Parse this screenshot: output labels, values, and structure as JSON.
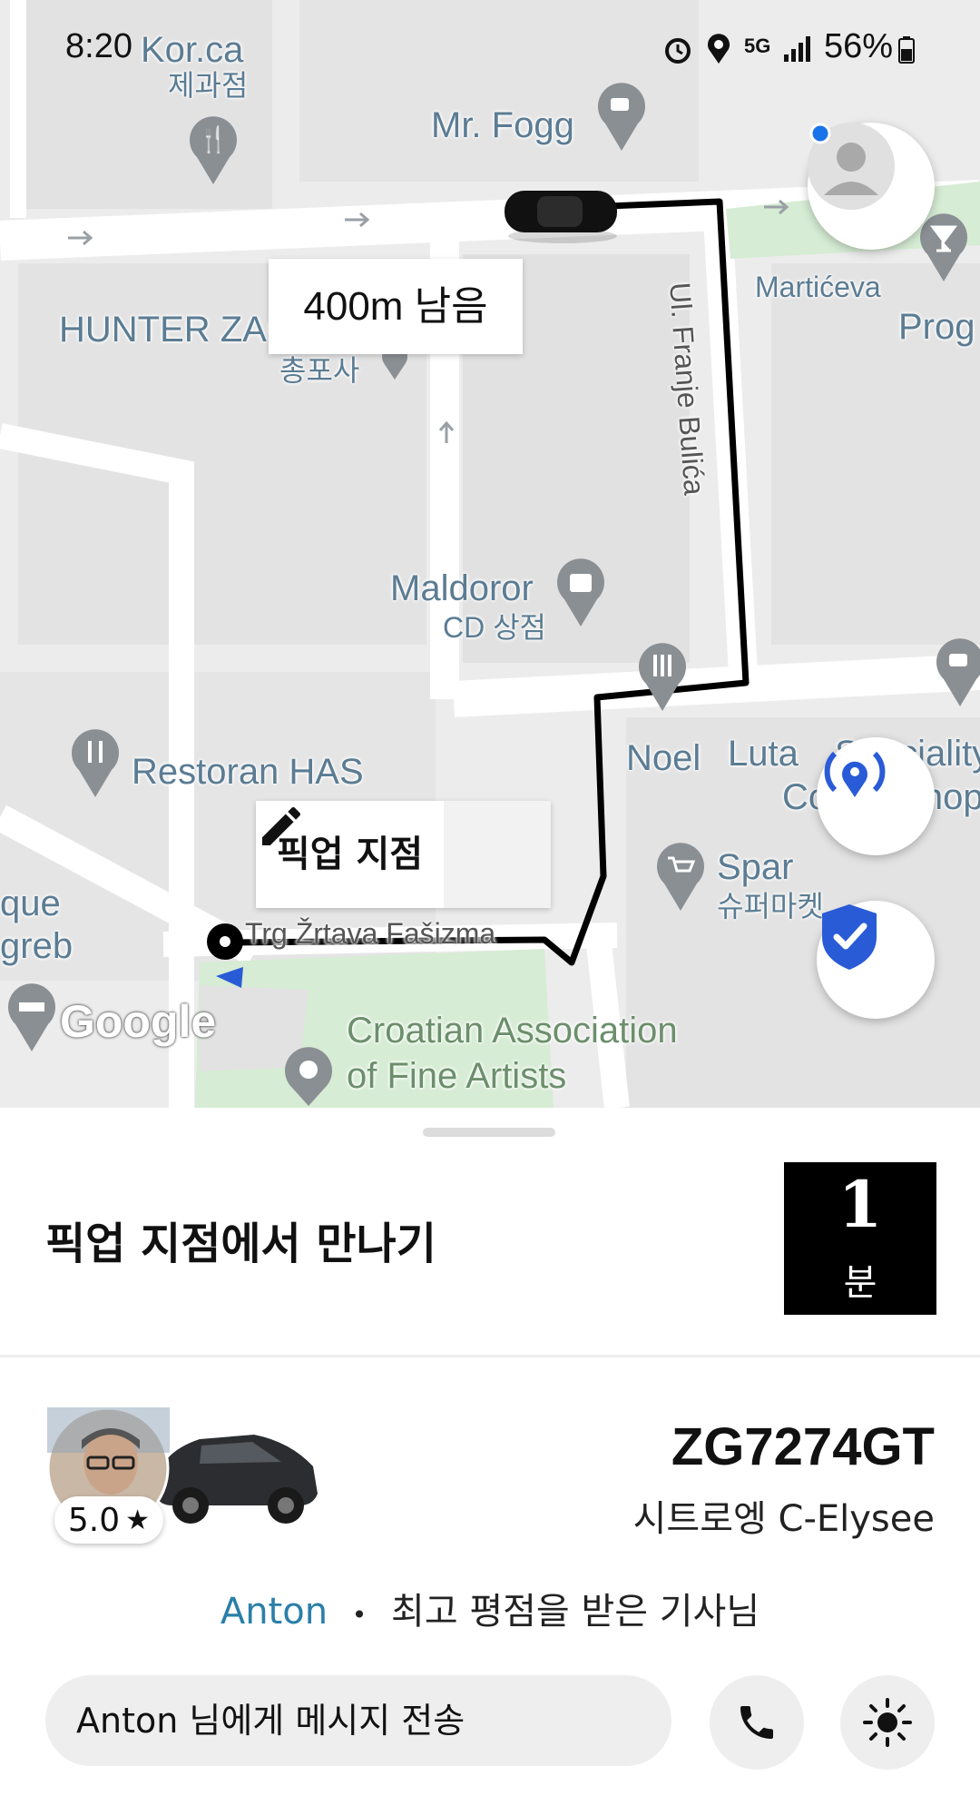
{
  "status_bar": {
    "time": "8:20",
    "battery": "56%",
    "network": "5G"
  },
  "map": {
    "distance_label": "400m 남음",
    "pickup_label": "픽업 지점",
    "google_logo": "Google",
    "pois": {
      "top_left_store_partial": "Kor.ca",
      "top_left_store_sub": "제과점",
      "mr_fogg": "Mr. Fogg",
      "marticeva": "Martićeva",
      "prog_partial": "Prog",
      "hunter": "HUNTER ZAG",
      "hunter_sub": "총포사",
      "street_franc": "Ul. Franje Bulića",
      "maldoror": "Maldoror",
      "maldoror_sub": "CD 상점",
      "restoran_has": "Restoran HAS",
      "noel": "Noel",
      "luta": "Luta",
      "speciality_partial": "Speciality",
      "coffee_shop_partial": "Coffee Shop",
      "spar": "Spar",
      "spar_sub": "슈퍼마켓",
      "que_partial": "que",
      "greb_partial": "greb",
      "trg": "Trg Žrtava Fašizma",
      "croatian_line1": "Croatian Association",
      "croatian_line2": "of Fine Artists"
    }
  },
  "sheet": {
    "title": "픽업 지점에서 만나기",
    "eta_number": "1",
    "eta_unit": "분",
    "plate": "ZG7274GT",
    "car_model": "시트로엥 C-Elysee",
    "rating": "5.0",
    "driver_name": "Anton",
    "driver_separator": "•",
    "driver_desc": "최고 평점을 받은 기사님",
    "message_placeholder": "Anton 님에게 메시지 전송"
  },
  "colors": {
    "route": "#000000",
    "park": "#d6ecd4",
    "poi_text": "#5b7c93",
    "shield": "#2a5bd7",
    "link": "#2a7fa8"
  }
}
